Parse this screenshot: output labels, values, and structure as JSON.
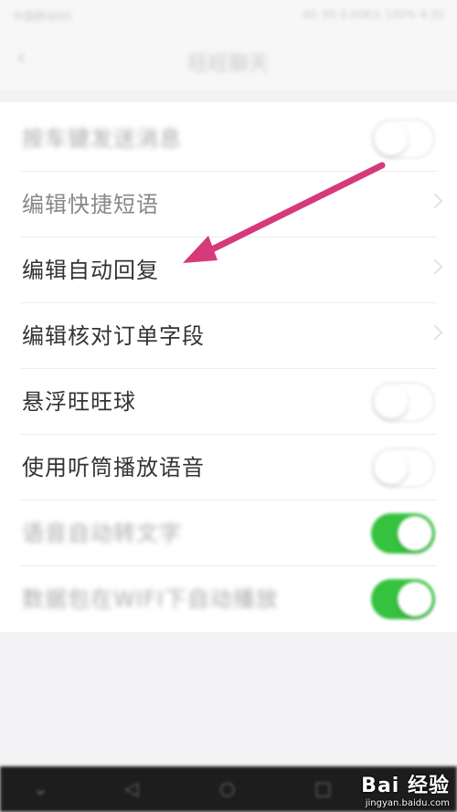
{
  "status_bar": {
    "left_text": "中国移动4G",
    "right_text": "4G 3G 0.00K/s 100% 4:35"
  },
  "header": {
    "back_icon": "back-arrow-icon",
    "title": "旺旺聊天"
  },
  "settings": {
    "items": [
      {
        "label": "按车键发送消息",
        "control": "toggle",
        "state": "off"
      },
      {
        "label": "编辑快捷短语",
        "control": "chevron"
      },
      {
        "label": "编辑自动回复",
        "control": "chevron"
      },
      {
        "label": "编辑核对订单字段",
        "control": "chevron"
      },
      {
        "label": "悬浮旺旺球",
        "control": "toggle",
        "state": "off"
      },
      {
        "label": "使用听筒播放语音",
        "control": "toggle",
        "state": "off"
      },
      {
        "label": "语音自动转文字",
        "control": "toggle",
        "state": "on"
      },
      {
        "label": "数据包在WIFI下自动播放",
        "control": "toggle",
        "state": "on"
      }
    ]
  },
  "annotation": {
    "color": "#d63a7a",
    "target": "编辑自动回复"
  },
  "colors": {
    "toggle_on": "#35c23f",
    "background": "#f3f3f5"
  },
  "watermark": {
    "brand": "Bai 经验",
    "url": "jingyan.baidu.com"
  }
}
